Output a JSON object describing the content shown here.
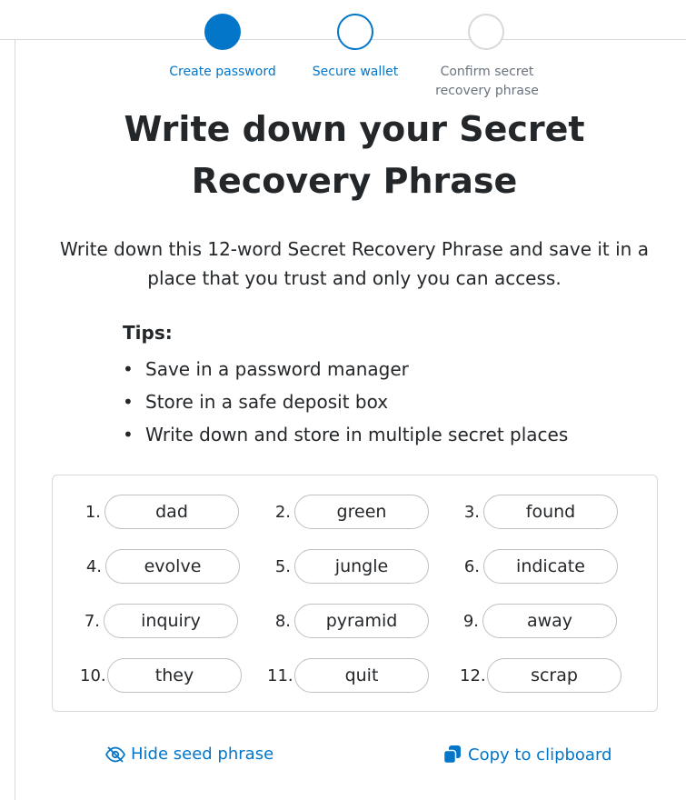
{
  "steps": [
    {
      "label": "Create password",
      "state": "complete"
    },
    {
      "label": "Secure wallet",
      "state": "active"
    },
    {
      "label": "Confirm secret\nrecovery phrase",
      "state": "pending"
    }
  ],
  "heading": "Write down your Secret Recovery Phrase",
  "description": "Write down this 12-word Secret Recovery Phrase and save it in a place that you trust and only you can access.",
  "tips": {
    "title": "Tips:",
    "items": [
      "Save in a password manager",
      "Store in a safe deposit box",
      "Write down and store in multiple secret places"
    ]
  },
  "phrase": [
    {
      "num": "1.",
      "word": "dad"
    },
    {
      "num": "2.",
      "word": "green"
    },
    {
      "num": "3.",
      "word": "found"
    },
    {
      "num": "4.",
      "word": "evolve"
    },
    {
      "num": "5.",
      "word": "jungle"
    },
    {
      "num": "6.",
      "word": "indicate"
    },
    {
      "num": "7.",
      "word": "inquiry"
    },
    {
      "num": "8.",
      "word": "pyramid"
    },
    {
      "num": "9.",
      "word": "away"
    },
    {
      "num": "10.",
      "word": "they"
    },
    {
      "num": "11.",
      "word": "quit"
    },
    {
      "num": "12.",
      "word": "scrap"
    }
  ],
  "actions": {
    "hide_label": "Hide seed phrase",
    "hide_icon": "eye-slash-icon",
    "copy_label": "Copy to clipboard",
    "copy_icon": "copy-icon"
  },
  "colors": {
    "primary": "#0376c9",
    "text": "#24272a",
    "muted": "#6a737d",
    "border": "#d6d9dc"
  }
}
